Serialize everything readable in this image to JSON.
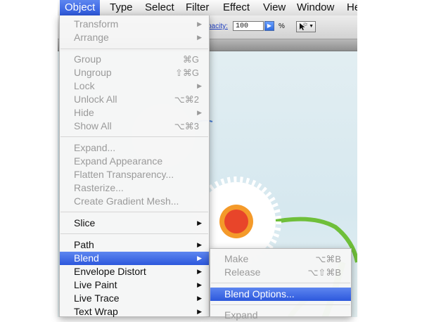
{
  "menubar": {
    "items": [
      "Object",
      "Type",
      "Select",
      "Filter",
      "Effect",
      "View",
      "Window",
      "He"
    ]
  },
  "controlbar": {
    "opacity_label": "pacity:",
    "opacity_value": "100",
    "percent": "%",
    "tool_button_icon": "selection-tool-icon"
  },
  "object_menu": {
    "items": [
      {
        "label": "Transform",
        "shortcut": "",
        "submenu": true,
        "enabled": false
      },
      {
        "label": "Arrange",
        "shortcut": "",
        "submenu": true,
        "enabled": false
      },
      {
        "label": "Group",
        "shortcut": "⌘G",
        "submenu": false,
        "enabled": false
      },
      {
        "label": "Ungroup",
        "shortcut": "⇧⌘G",
        "submenu": false,
        "enabled": false
      },
      {
        "label": "Lock",
        "shortcut": "",
        "submenu": true,
        "enabled": false
      },
      {
        "label": "Unlock All",
        "shortcut": "⌥⌘2",
        "submenu": false,
        "enabled": false
      },
      {
        "label": "Hide",
        "shortcut": "",
        "submenu": true,
        "enabled": false
      },
      {
        "label": "Show All",
        "shortcut": "⌥⌘3",
        "submenu": false,
        "enabled": false
      },
      {
        "label": "Expand...",
        "shortcut": "",
        "submenu": false,
        "enabled": false
      },
      {
        "label": "Expand Appearance",
        "shortcut": "",
        "submenu": false,
        "enabled": false
      },
      {
        "label": "Flatten Transparency...",
        "shortcut": "",
        "submenu": false,
        "enabled": false
      },
      {
        "label": "Rasterize...",
        "shortcut": "",
        "submenu": false,
        "enabled": false
      },
      {
        "label": "Create Gradient Mesh...",
        "shortcut": "",
        "submenu": false,
        "enabled": false
      },
      {
        "label": "Slice",
        "shortcut": "",
        "submenu": true,
        "enabled": true
      },
      {
        "label": "Path",
        "shortcut": "",
        "submenu": true,
        "enabled": true
      },
      {
        "label": "Blend",
        "shortcut": "",
        "submenu": true,
        "enabled": true,
        "highlighted": true
      },
      {
        "label": "Envelope Distort",
        "shortcut": "",
        "submenu": true,
        "enabled": true
      },
      {
        "label": "Live Paint",
        "shortcut": "",
        "submenu": true,
        "enabled": true
      },
      {
        "label": "Live Trace",
        "shortcut": "",
        "submenu": true,
        "enabled": true
      },
      {
        "label": "Text Wrap",
        "shortcut": "",
        "submenu": true,
        "enabled": true
      }
    ]
  },
  "blend_menu": {
    "items": [
      {
        "label": "Make",
        "shortcut": "⌥⌘B",
        "enabled": false
      },
      {
        "label": "Release",
        "shortcut": "⌥⇧⌘B",
        "enabled": false
      },
      {
        "label": "Blend Options...",
        "shortcut": "",
        "enabled": true,
        "highlighted": true
      },
      {
        "label": "Expand",
        "shortcut": "",
        "enabled": false
      }
    ]
  },
  "colors": {
    "highlight": "#3a64e6",
    "flower_center": "#e8452a",
    "flower_ring": "#f49a2a",
    "stem": "#6fbf3a"
  }
}
